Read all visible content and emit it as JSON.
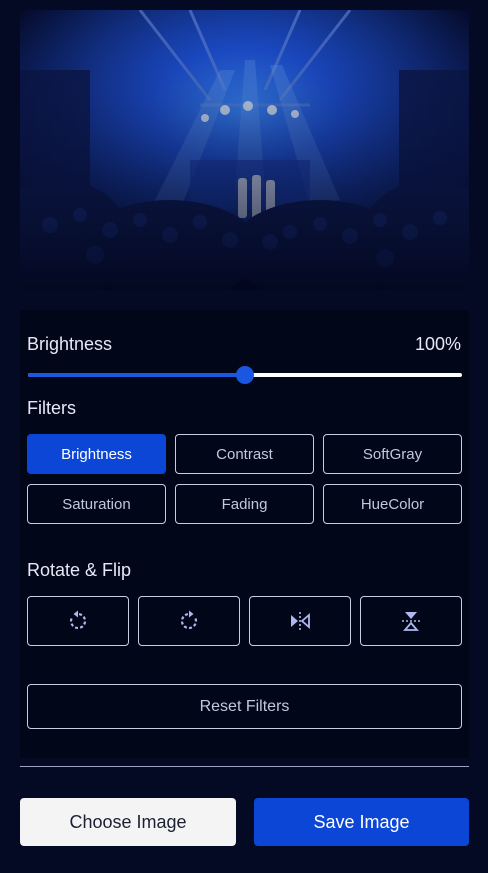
{
  "preview": {
    "image": "concert-crowd-stage-photo"
  },
  "slider": {
    "label": "Brightness",
    "value_text": "100%",
    "fraction": 0.5
  },
  "filters": {
    "title": "Filters",
    "items": [
      {
        "label": "Brightness",
        "active": true
      },
      {
        "label": "Contrast",
        "active": false
      },
      {
        "label": "SoftGray",
        "active": false
      },
      {
        "label": "Saturation",
        "active": false
      },
      {
        "label": "Fading",
        "active": false
      },
      {
        "label": "HueColor",
        "active": false
      }
    ]
  },
  "rotate": {
    "title": "Rotate & Flip",
    "icons": [
      "rotate-left-icon",
      "rotate-right-icon",
      "flip-horizontal-icon",
      "flip-vertical-icon"
    ]
  },
  "reset": {
    "label": "Reset Filters"
  },
  "actions": {
    "choose_label": "Choose Image",
    "save_label": "Save Image"
  },
  "colors": {
    "background": "#040a24",
    "panel": "#020619",
    "accent": "#0b46d6",
    "border": "#c8cde4",
    "icon": "#aeb8ee"
  }
}
